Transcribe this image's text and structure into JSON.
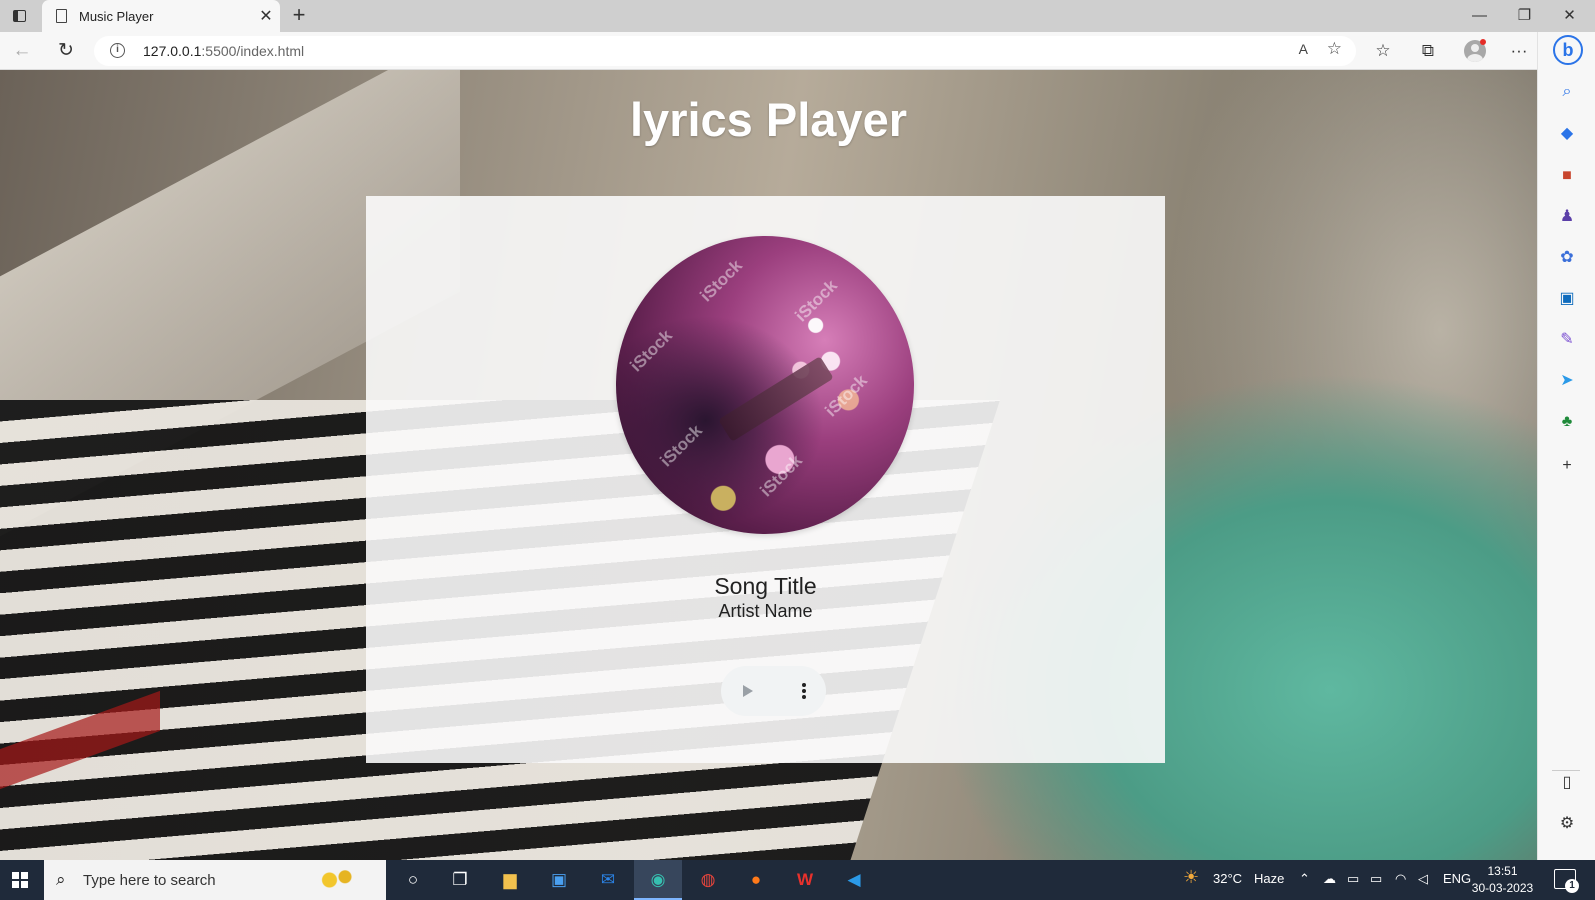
{
  "browser": {
    "tab_title": "Music Player",
    "tab_close": "✕",
    "new_tab": "+",
    "url_host": "127.0.0.1",
    "url_rest": ":5500/index.html",
    "window_controls": {
      "minimize": "—",
      "maximize": "❐",
      "close": "✕"
    },
    "nav": {
      "back": "←",
      "reload": "↻"
    },
    "toolbar_icons": [
      "read-aloud-icon",
      "favorites-add-icon",
      "favorites-icon",
      "collections-icon",
      "profile-icon",
      "more-icon"
    ]
  },
  "sidebar": {
    "bing": "b",
    "icons": [
      "search-icon",
      "shopping-icon",
      "tools-icon",
      "games-icon",
      "office-icon",
      "outlook-icon",
      "designer-icon",
      "send-icon",
      "tree-icon",
      "add-icon",
      "split-screen-icon",
      "settings-icon"
    ]
  },
  "page": {
    "title": "lyrics Player",
    "song_title": "Song Title",
    "artist_name": "Artist Name",
    "watermark": "iStock"
  },
  "taskbar": {
    "search_placeholder": "Type here to search",
    "weather_temp": "32°C",
    "weather_text": "Haze",
    "language": "ENG",
    "time": "13:51",
    "date": "30-03-2023",
    "notification_count": "1"
  },
  "colors": {
    "accent": "#2b74e8",
    "taskbar": "#1f2a3a",
    "card": "#fafafa"
  }
}
